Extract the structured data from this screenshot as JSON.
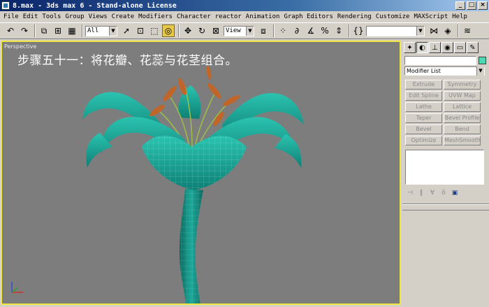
{
  "window": {
    "title": "8.max - 3ds max 6 - Stand-alone License",
    "min_label": "_",
    "max_label": "□",
    "close_label": "×"
  },
  "menu": [
    "File",
    "Edit",
    "Tools",
    "Group",
    "Views",
    "Create",
    "Modifiers",
    "Character",
    "reactor",
    "Animation",
    "Graph Editors",
    "Rendering",
    "Customize",
    "MAXScript",
    "Help"
  ],
  "toolbar": {
    "selection_filter": "All",
    "ref_coord": "View",
    "named_selection": ""
  },
  "viewport": {
    "label": "Perspective",
    "caption": "步骤五十一：将花瓣、花蕊与花茎组合。",
    "colors": {
      "background": "#7d7d7d",
      "border": "#f2e640",
      "petal": "#1ea89a",
      "stamen": "#c0662a"
    }
  },
  "command_panel": {
    "object_color": "#4fd6b3",
    "modifier_list": "Modifier List",
    "modifiers": [
      "Extrude",
      "Symmetry",
      "Edit Spline",
      "UVW Map",
      "Lathe",
      "Lattice",
      "Taper",
      "Bevel Profile",
      "Bevel",
      "Bend",
      "Optimize",
      "MeshSmooth"
    ]
  }
}
